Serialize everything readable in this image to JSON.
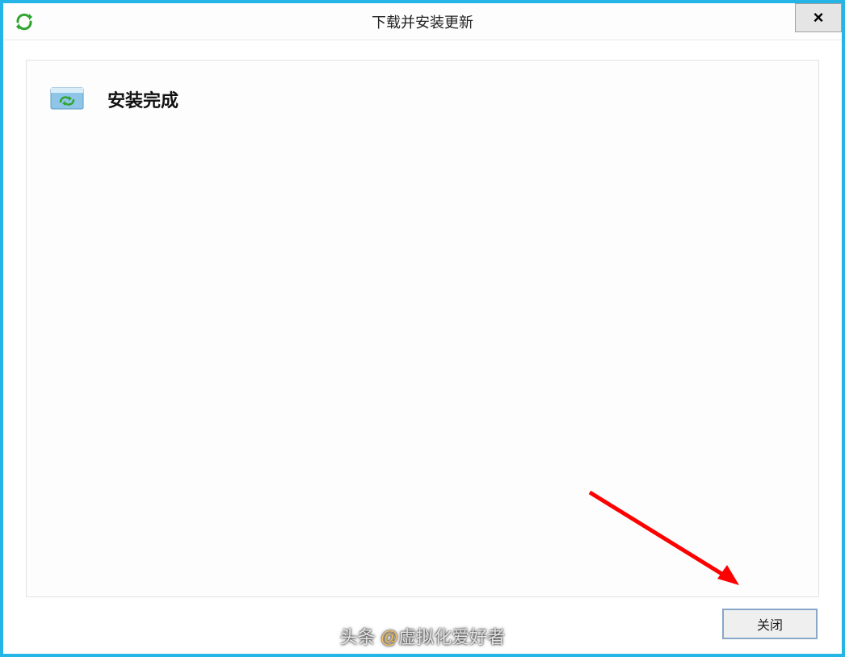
{
  "window": {
    "title": "下载并安装更新"
  },
  "main": {
    "status_heading": "安装完成"
  },
  "footer": {
    "close_label": "关闭"
  },
  "close_button": {
    "symbol": "×"
  },
  "watermark": {
    "prefix": "头条",
    "at": "@",
    "user": "虚拟化爱好者"
  }
}
